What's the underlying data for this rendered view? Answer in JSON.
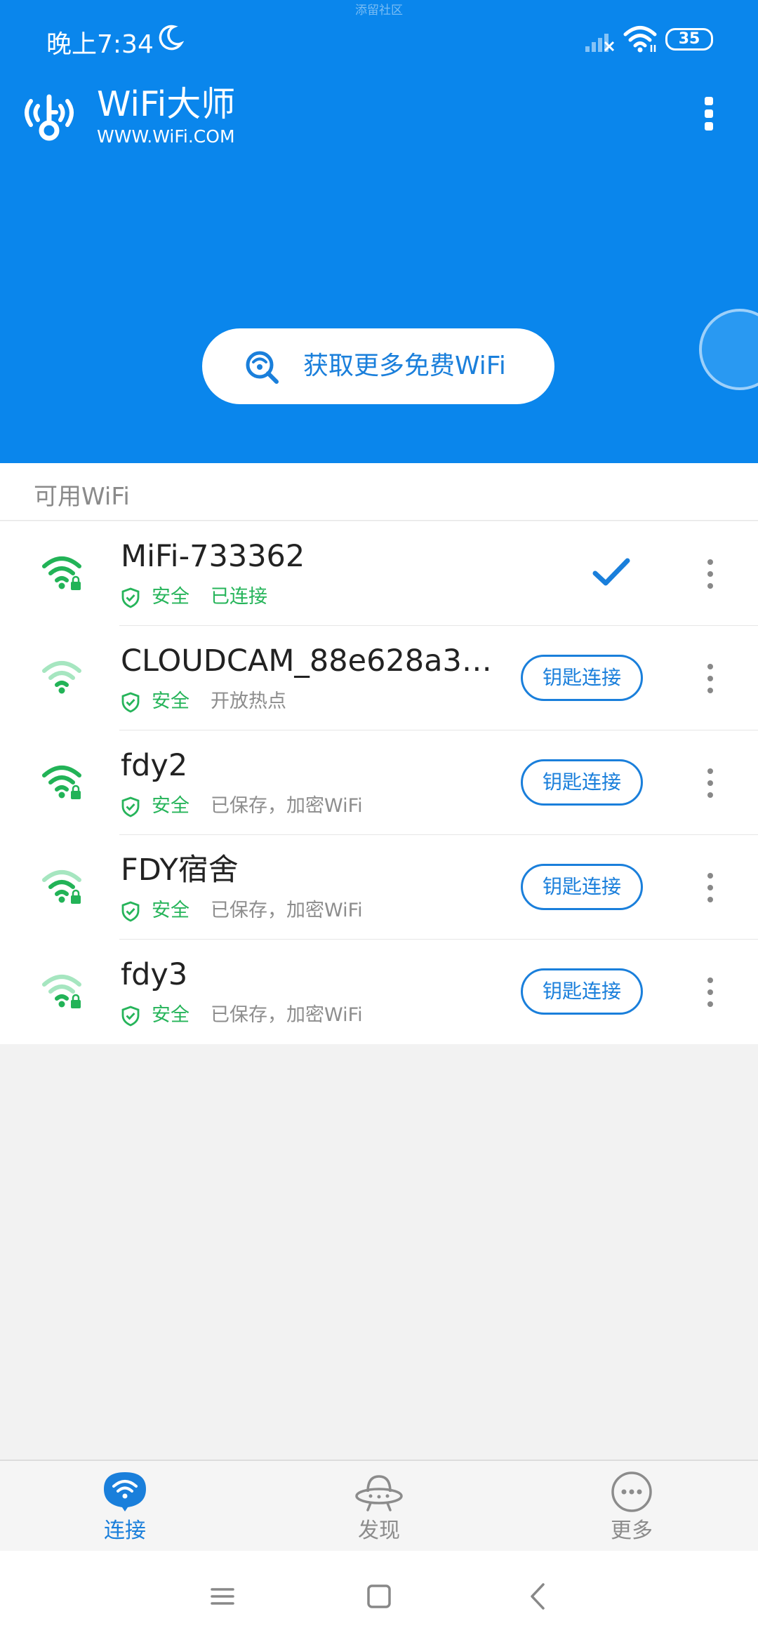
{
  "watermark": "添留社区",
  "status_bar": {
    "time": "晚上7:34",
    "battery": "35"
  },
  "app": {
    "title": "WiFi大师",
    "subtitle": "WWW.WiFi.COM"
  },
  "get_more_button": {
    "label": "获取更多免费WiFi"
  },
  "section_header": "可用WiFi",
  "networks": [
    {
      "name": "MiFi-733362",
      "safety": "安全",
      "status": "已连接",
      "connected": true,
      "locked": true,
      "signal": "strong"
    },
    {
      "name": "CLOUDCAM_88e628a368...",
      "safety": "安全",
      "status": "开放热点",
      "connected": false,
      "locked": false,
      "signal": "weak",
      "action": "钥匙连接"
    },
    {
      "name": "fdy2",
      "safety": "安全",
      "status": "已保存，加密WiFi",
      "connected": false,
      "locked": true,
      "signal": "strong",
      "action": "钥匙连接"
    },
    {
      "name": "FDY宿舍",
      "safety": "安全",
      "status": "已保存，加密WiFi",
      "connected": false,
      "locked": true,
      "signal": "medium",
      "action": "钥匙连接"
    },
    {
      "name": "fdy3",
      "safety": "安全",
      "status": "已保存，加密WiFi",
      "connected": false,
      "locked": true,
      "signal": "weak",
      "action": "钥匙连接"
    }
  ],
  "tabs": [
    {
      "label": "连接",
      "icon": "wifi-bubble-icon",
      "active": true
    },
    {
      "label": "发现",
      "icon": "ufo-icon",
      "active": false
    },
    {
      "label": "更多",
      "icon": "more-circle-icon",
      "active": false
    }
  ],
  "colors": {
    "brand": "#0a86ec",
    "accent": "#1a7fdb",
    "safe": "#26b45a",
    "wifi_strong": "#22b357",
    "wifi_weak": "#a6e6c0"
  }
}
